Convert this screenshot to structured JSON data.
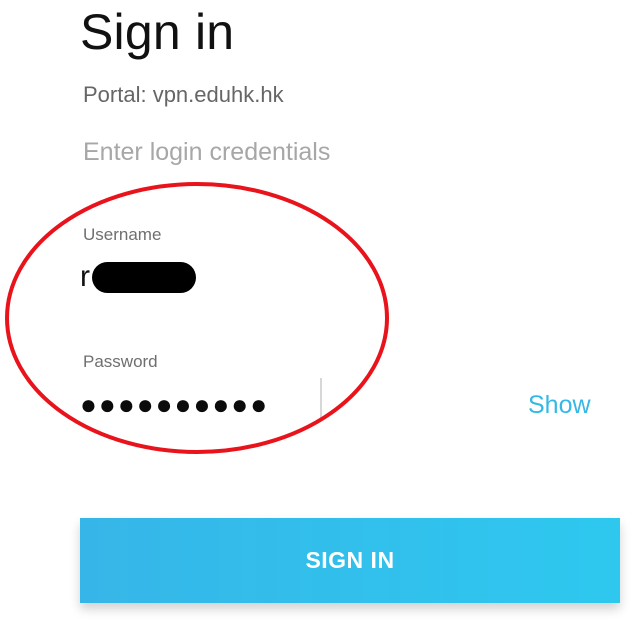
{
  "screen": {
    "title": "Sign in",
    "portal_text": "Portal: vpn.eduhk.hk",
    "prompt_text": "Enter login credentials"
  },
  "form": {
    "username_label": "Username",
    "username_value": "r          n",
    "password_label": "Password",
    "password_mask": "●●●●●●●●●●",
    "show_label": "Show",
    "signin_label": "SIGN IN"
  },
  "colors": {
    "accent": "#36b8e6",
    "annotation": "#e8131b"
  },
  "annotation": {
    "shape": "ellipse",
    "color": "#e8131b"
  },
  "icons": {
    "redaction": "redaction-bar",
    "annotation": "red-ellipse"
  }
}
